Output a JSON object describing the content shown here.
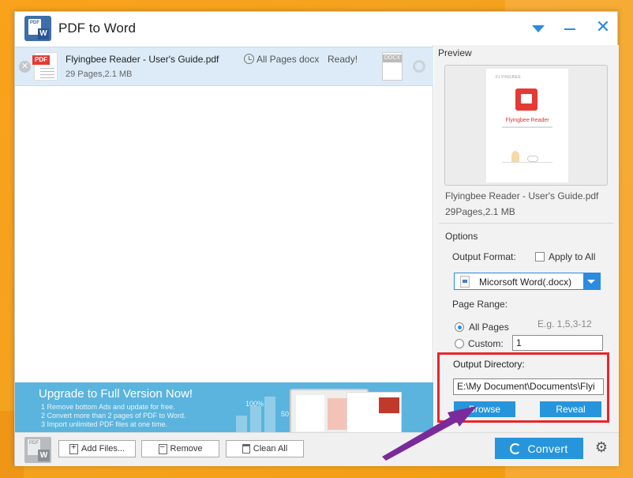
{
  "window": {
    "title": "PDF to Word"
  },
  "app_logo": {
    "pdf_text": "PDF",
    "word_text": "W"
  },
  "file_list": {
    "rows": [
      {
        "pdf_tag": "PDF",
        "name": "Flyingbee Reader - User's Guide.pdf",
        "meta": "29 Pages,2.1 MB",
        "pages": "All Pages",
        "format": "docx",
        "status": "Ready!",
        "docx_tag": "DOCX"
      }
    ]
  },
  "ad": {
    "title": "Upgrade to Full Version Now!",
    "lines": [
      "1 Remove bottom Ads and update for free.",
      "2 Convert more than 2 pages of PDF to Word.",
      "3 Import unlimited PDF files at one time."
    ],
    "pct_a": "100%",
    "pct_b": "50"
  },
  "toolbar": {
    "add_label": "Add Files...",
    "remove_label": "Remove",
    "clean_label": "Clean All",
    "convert_label": "Convert"
  },
  "preview": {
    "title": "Preview",
    "thumb_brand": "FLYINGBEE",
    "thumb_title": "Flyingbee Reader",
    "file_name": "Flyingbee Reader - User's Guide.pdf",
    "file_size": "29Pages,2.1 MB"
  },
  "options": {
    "title": "Options",
    "output_format_label": "Output Format:",
    "apply_to_all_label": "Apply to All",
    "format_value": "Micorsoft Word(.docx)",
    "page_range_label": "Page Range:",
    "all_pages_label": "All Pages",
    "custom_label": "Custom:",
    "example_text": "E.g. 1,5,3-12",
    "custom_value": "1",
    "all_pages_selected": true,
    "output_directory_label": "Output Directory:",
    "output_directory_value": "E:\\My Document\\Documents\\Flyi",
    "browse_label": "Browse",
    "reveal_label": "Reveal"
  },
  "colors": {
    "accent": "#2795db",
    "highlight": "#e8262b",
    "arrow": "#7a2a9a",
    "wallpaper": "#f4a31f"
  }
}
